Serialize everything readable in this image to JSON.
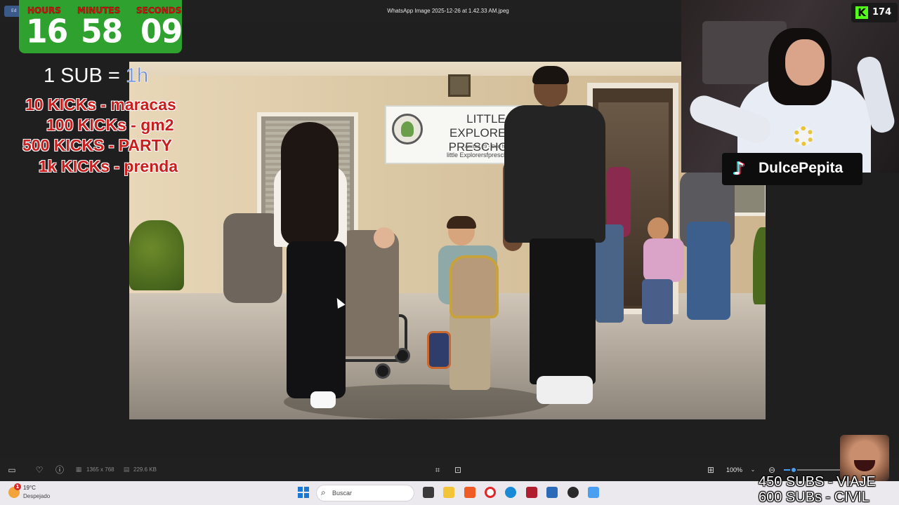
{
  "window": {
    "title": "WhatsApp Image 2025-12-26 at 1.42.33 AM.jpeg",
    "edit_chip": "Ed"
  },
  "photo": {
    "sign_title": "LITTLE EXPLORERS PRESCHOOL",
    "sign_sub": "Amitad 29 - Ooo haa",
    "sign_url": "little Explorersfpreschool.co"
  },
  "timer": {
    "hours_label": "HOURS",
    "minutes_label": "MINUTES",
    "seconds_label": "SECONDS",
    "hours": "16",
    "minutes": "58",
    "seconds": "09",
    "color": "#2ea12e",
    "label_color": "#e01414"
  },
  "goals": {
    "sub_rule_prefix": "1 SUB = ",
    "sub_rule_value": "1h",
    "kicks": [
      "10 KICKs - maracas",
      "100 KICKs -  gm2",
      "500 KICKS - PARTY",
      "1k KICKs - prenda"
    ],
    "subs": [
      "450 SUBS - VIAJE",
      "600 SUBs - CIVIL"
    ],
    "kick_color": "#c81e1e"
  },
  "stream": {
    "kick_viewers": "174",
    "kick_logo": "K",
    "kick_color": "#53fc18",
    "tiktok_handle": "DulcePepita",
    "tiktok_icon": "tiktok-icon"
  },
  "toolbar": {
    "dimensions": "1365 x 768",
    "file_size": "229.6 KB",
    "zoom": "100%",
    "zoom_level": 0.18
  },
  "taskbar": {
    "temperature": "19°C",
    "weather": "Despejado",
    "weather_badge": "1",
    "search_placeholder": "Buscar"
  }
}
